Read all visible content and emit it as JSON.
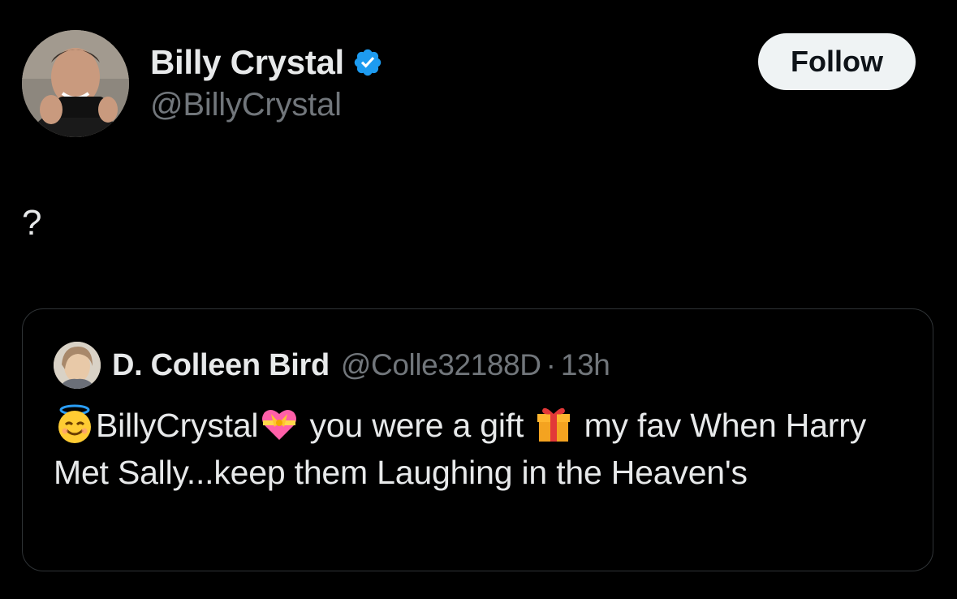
{
  "author": {
    "display_name": "Billy Crystal",
    "handle": "@BillyCrystal",
    "verified": true,
    "verified_color": "#1d9bf0"
  },
  "follow_button": {
    "label": "Follow"
  },
  "post": {
    "text": "?"
  },
  "quoted_post": {
    "display_name": "D. Colleen Bird",
    "handle": "@Colle32188D",
    "separator": "·",
    "time": "13h",
    "body": {
      "emoji_1": "smiling-face-with-halo",
      "segment_1": "BillyCrystal",
      "emoji_2": "heart-with-ribbon",
      "segment_2": " you were a gift ",
      "emoji_3": "wrapped-gift",
      "segment_3": " my fav When Harry Met Sally...keep them Laughing in the Heaven's"
    }
  },
  "colors": {
    "background": "#000000",
    "primary_text": "#e7e9ea",
    "secondary_text": "#71767b",
    "border": "#2f3336",
    "follow_bg": "#eff3f4",
    "follow_text": "#0f1419"
  }
}
